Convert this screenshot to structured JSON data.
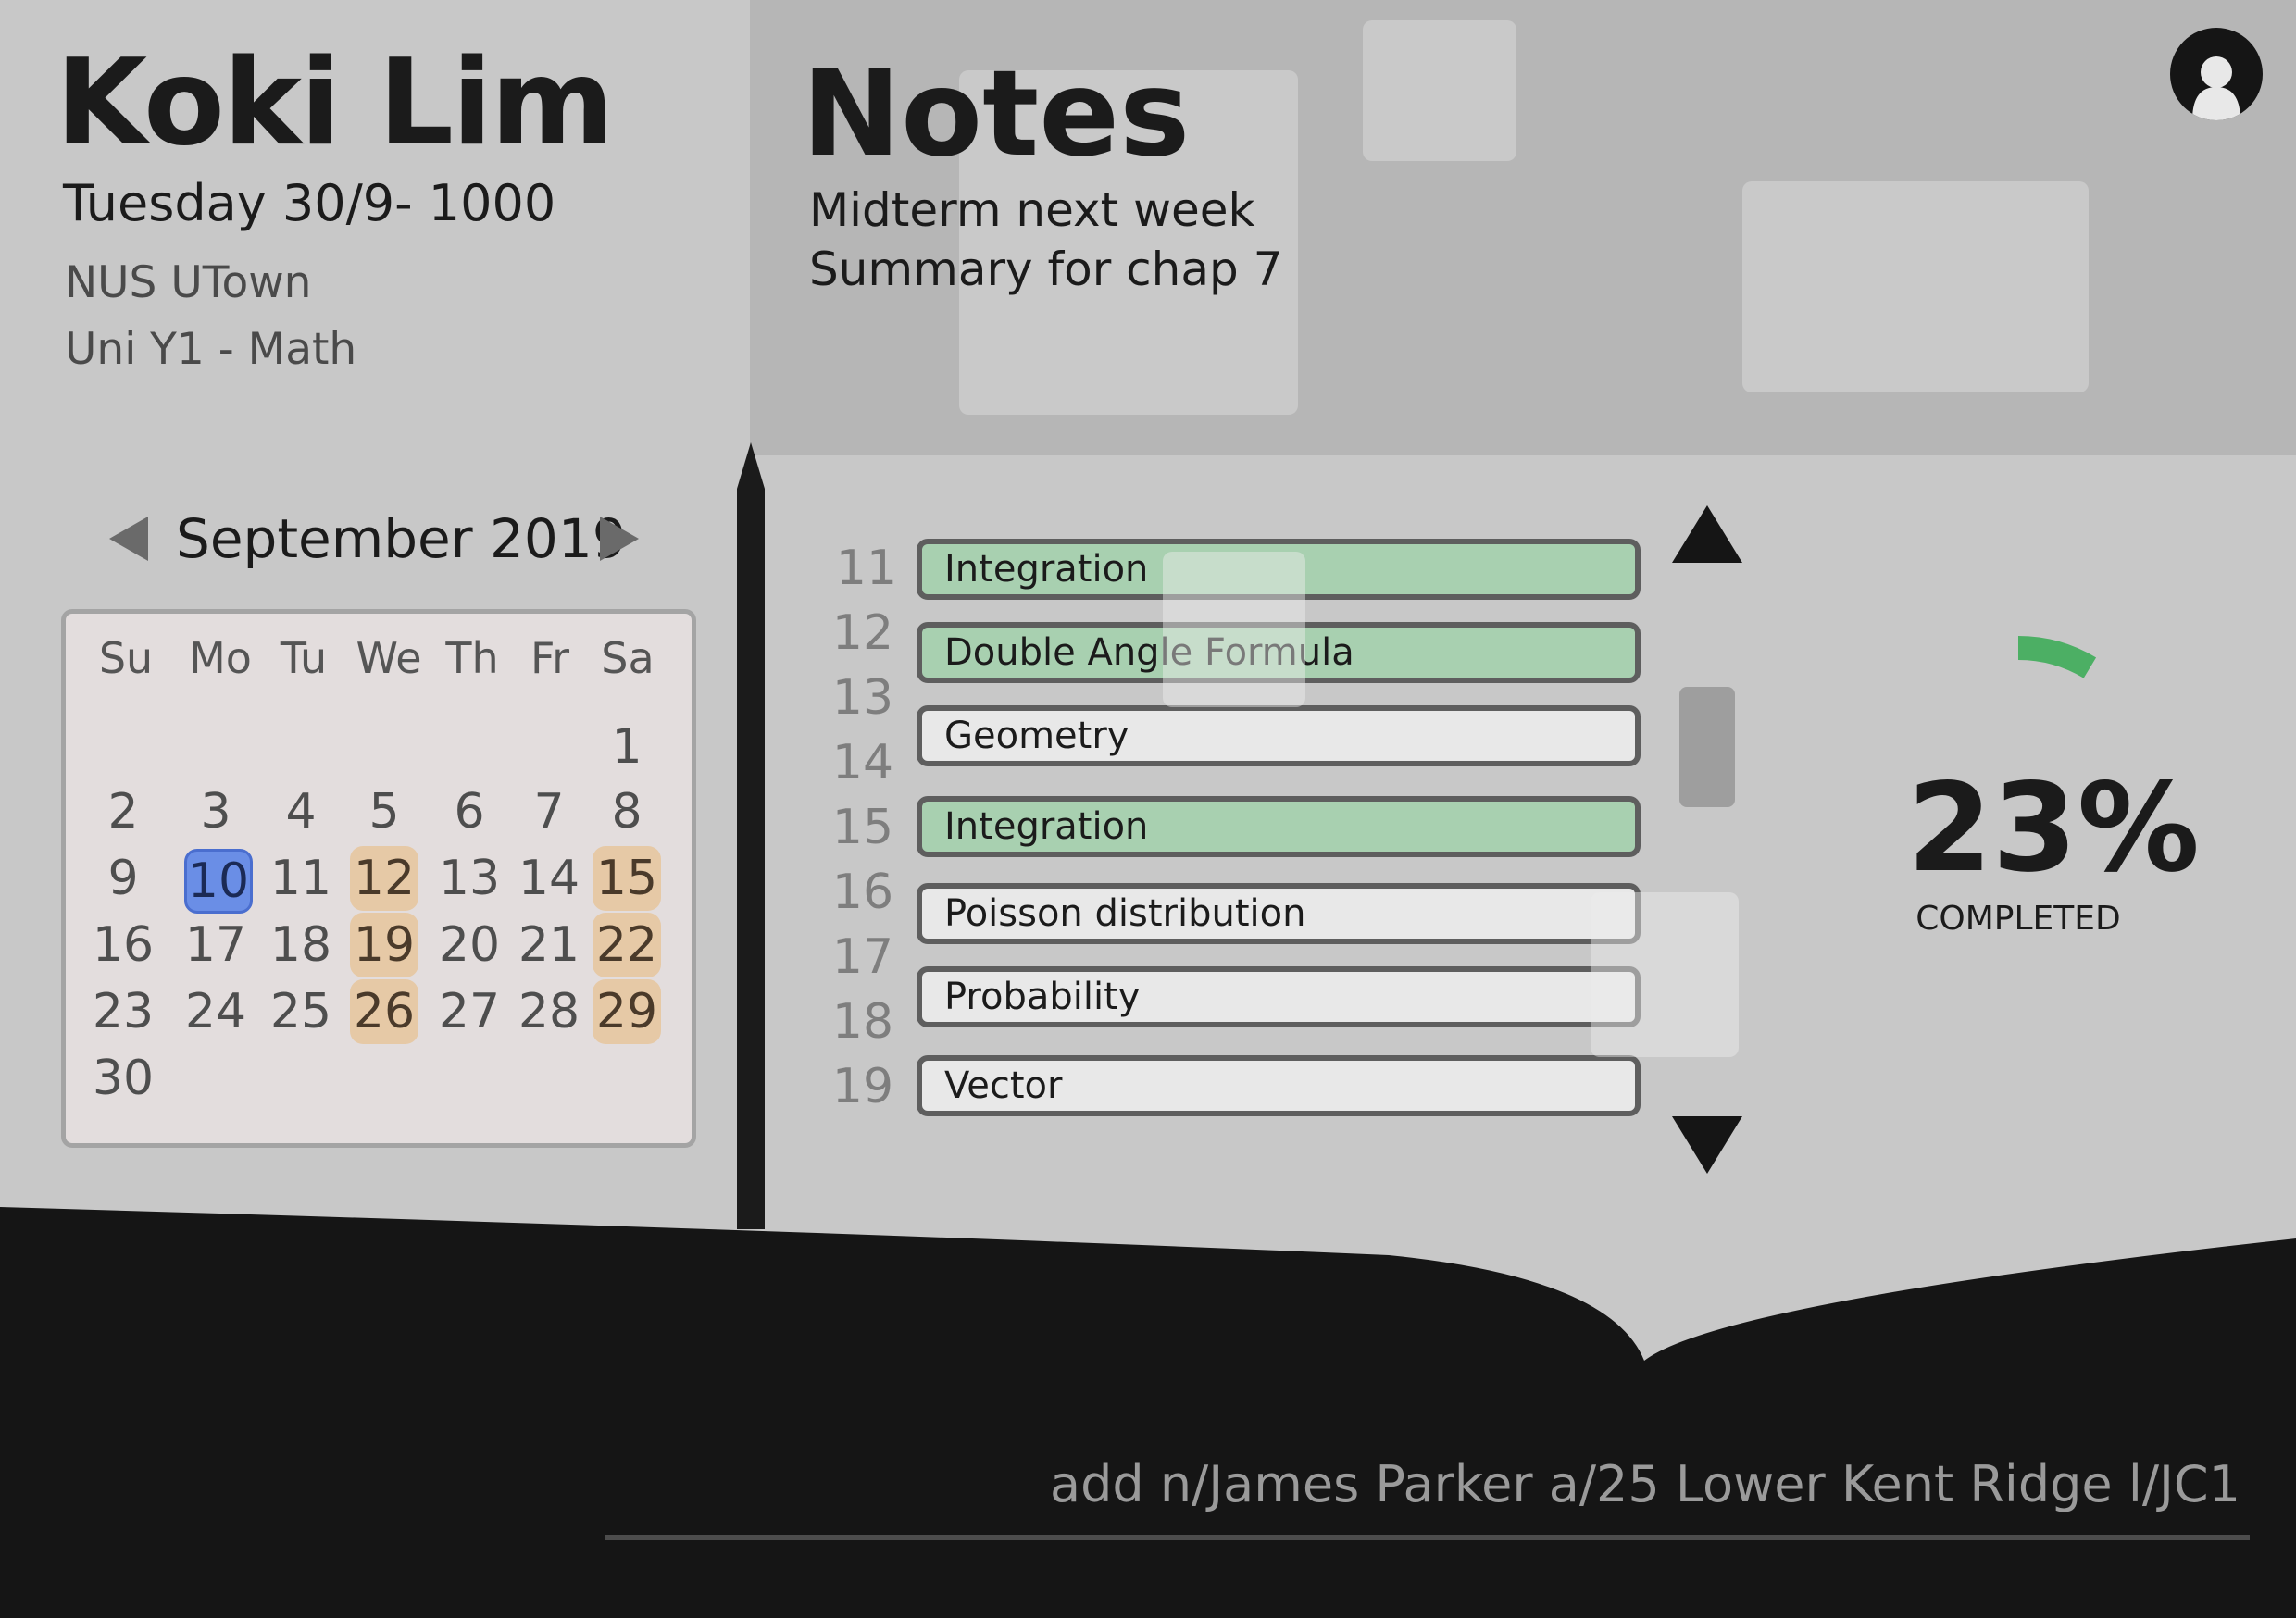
{
  "profile": {
    "name": "Koki Lim",
    "datetime": "Tuesday 30/9- 1000",
    "location": "NUS UTown",
    "class": "Uni Y1 - Math"
  },
  "notes": {
    "title": "Notes",
    "lines": [
      "Midterm next week",
      "Summary for chap 7"
    ]
  },
  "calendar": {
    "month_label": "September 2019",
    "weekdays": [
      "Su",
      "Mo",
      "Tu",
      "We",
      "Th",
      "Fr",
      "Sa"
    ],
    "days": [
      "1",
      "2",
      "3",
      "4",
      "5",
      "6",
      "7",
      "8",
      "9",
      "10",
      "11",
      "12",
      "13",
      "14",
      "15",
      "16",
      "17",
      "18",
      "19",
      "20",
      "21",
      "22",
      "23",
      "24",
      "25",
      "26",
      "27",
      "28",
      "29",
      "30"
    ],
    "today": "10",
    "highlighted": [
      "12",
      "15",
      "19",
      "22",
      "26",
      "29"
    ],
    "today_color": "#6a8ee6",
    "event_color": "#e6c9a6"
  },
  "topics": {
    "line_numbers": [
      "11",
      "12",
      "13",
      "14",
      "15",
      "16",
      "17",
      "18",
      "19"
    ],
    "items": [
      {
        "label": "Integration",
        "completed": true
      },
      {
        "label": "Double Angle Formula",
        "completed": true
      },
      {
        "label": "Geometry",
        "completed": false
      },
      {
        "label": "Integration",
        "completed": true
      },
      {
        "label": "Poisson distribution",
        "completed": false
      },
      {
        "label": "Probability",
        "completed": false
      },
      {
        "label": "Vector",
        "completed": false
      }
    ],
    "completed_color": "#a8d0b0"
  },
  "progress": {
    "value": "23%",
    "fraction": 0.23,
    "label": "COMPLETED",
    "arc_color": "#4caf64"
  },
  "command": {
    "text": "add n/James Parker  a/25 Lower Kent Ridge l/JC1"
  },
  "icons": {
    "avatar": "user-avatar-icon",
    "calendar_prev": "triangle-left-icon",
    "calendar_next": "triangle-right-icon",
    "scroll_up": "triangle-up-icon",
    "scroll_down": "triangle-down-icon"
  }
}
